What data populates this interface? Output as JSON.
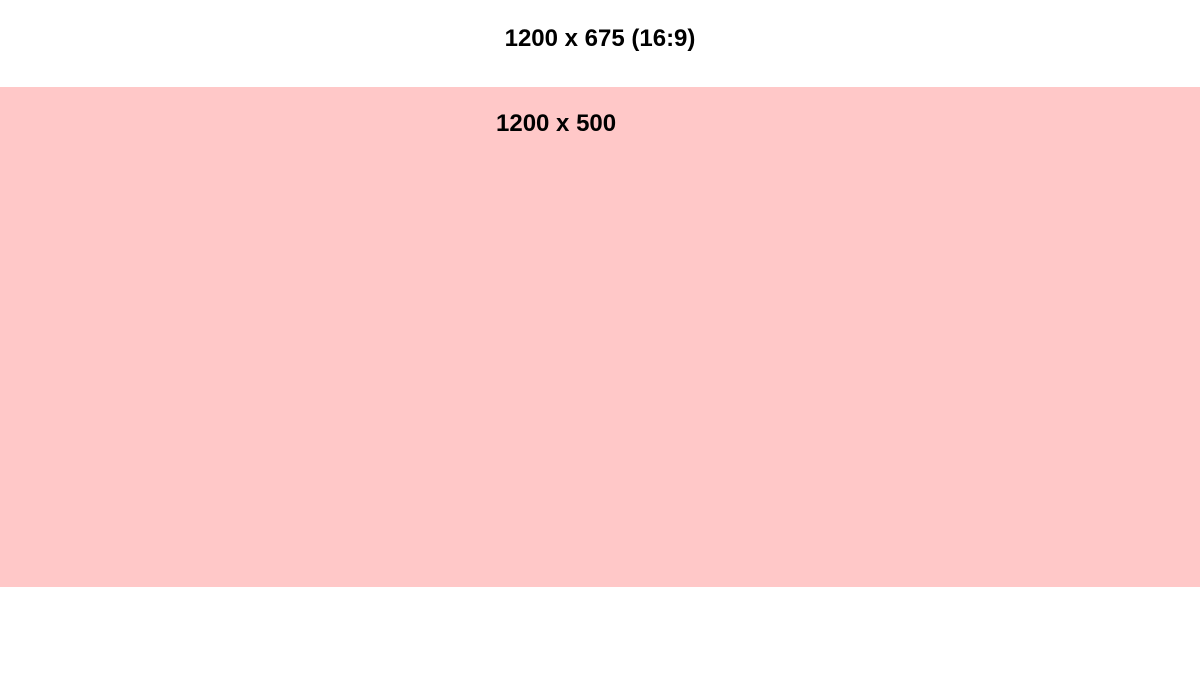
{
  "canvas": {
    "label": "1200 x 675 (16:9)",
    "background_color": "#ffffff"
  },
  "band": {
    "label": "1200 x 500",
    "background_color": "#ffc8c8"
  },
  "text_color": "#000000"
}
